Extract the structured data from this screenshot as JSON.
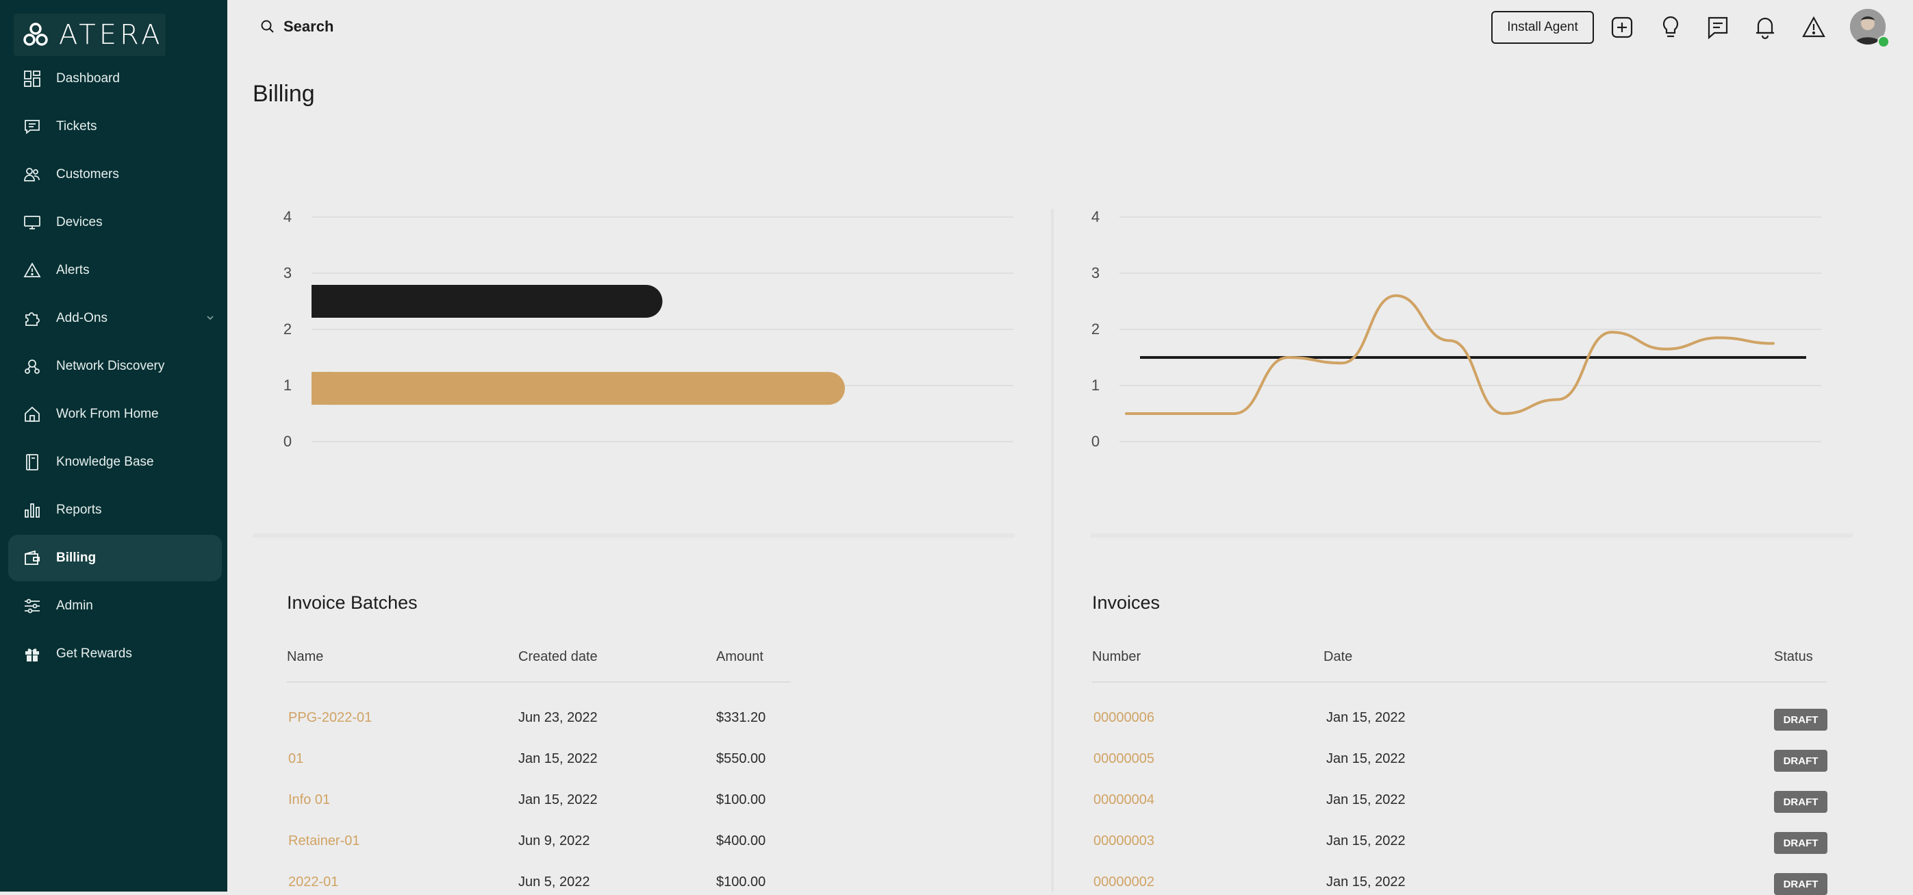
{
  "app": {
    "logo_text": "ATERA"
  },
  "sidebar": {
    "items": [
      {
        "label": "Dashboard",
        "icon": "dashboard-icon"
      },
      {
        "label": "Tickets",
        "icon": "tickets-icon"
      },
      {
        "label": "Customers",
        "icon": "customers-icon"
      },
      {
        "label": "Devices",
        "icon": "devices-icon"
      },
      {
        "label": "Alerts",
        "icon": "alerts-icon"
      },
      {
        "label": "Add-Ons",
        "icon": "addons-icon"
      },
      {
        "label": "Network Discovery",
        "icon": "network-icon"
      },
      {
        "label": "Work From Home",
        "icon": "home-icon"
      },
      {
        "label": "Knowledge Base",
        "icon": "book-icon"
      },
      {
        "label": "Reports",
        "icon": "reports-icon"
      },
      {
        "label": "Billing",
        "icon": "wallet-icon",
        "active": true
      },
      {
        "label": "Admin",
        "icon": "sliders-icon"
      },
      {
        "label": "Get Rewards",
        "icon": "gift-icon"
      }
    ]
  },
  "topbar": {
    "search_label": "Search",
    "install_agent": "Install Agent",
    "icons": [
      "plus-icon",
      "lightbulb-icon",
      "chat-icon",
      "bell-icon",
      "warning-icon"
    ]
  },
  "page": {
    "title": "Billing"
  },
  "colors": {
    "accent": "#d0a364",
    "sidebar": "#063033",
    "dark_bar": "#1c1c1c"
  },
  "chart_data": [
    {
      "type": "bar",
      "orientation": "horizontal",
      "y_ticks": [
        "4",
        "3",
        "2",
        "1",
        "0"
      ],
      "ylim": [
        0,
        4
      ],
      "series": [
        {
          "values": [
            2.5
          ],
          "color": "#1c1c1c"
        },
        {
          "values": [
            1
          ],
          "color": "#d0a364"
        }
      ],
      "bar_values_relative": [
        0.5,
        0.76
      ],
      "grid": true
    },
    {
      "type": "line",
      "y_ticks": [
        "4",
        "3",
        "2",
        "1",
        "0"
      ],
      "ylim": [
        0,
        4
      ],
      "series": [
        {
          "values": [
            0.5,
            0.5,
            0.5,
            1.5,
            1.4,
            2.6,
            1.8,
            0.5,
            0.75,
            1.95,
            1.65,
            1.85,
            1.75
          ],
          "color": "#d0a364"
        },
        {
          "values": [
            1.5,
            1.5
          ],
          "color": "#1c1c1c"
        }
      ],
      "grid": true
    }
  ],
  "invoice_batches": {
    "title": "Invoice Batches",
    "headers": [
      "Name",
      "Created date",
      "Amount"
    ],
    "rows": [
      {
        "name": "PPG-2022-01",
        "date": "Jun 23, 2022",
        "amount": "$331.20"
      },
      {
        "name": "01",
        "date": "Jan 15, 2022",
        "amount": "$550.00"
      },
      {
        "name": "Info 01",
        "date": "Jan 15, 2022",
        "amount": "$100.00"
      },
      {
        "name": "Retainer-01",
        "date": "Jun 9, 2022",
        "amount": "$400.00"
      },
      {
        "name": "2022-01",
        "date": "Jun 5, 2022",
        "amount": "$100.00"
      }
    ]
  },
  "invoices": {
    "title": "Invoices",
    "headers": [
      "Number",
      "Date",
      "Status"
    ],
    "rows": [
      {
        "number": "00000006",
        "date": "Jan 15, 2022",
        "status": "DRAFT"
      },
      {
        "number": "00000005",
        "date": "Jan 15, 2022",
        "status": "DRAFT"
      },
      {
        "number": "00000004",
        "date": "Jan 15, 2022",
        "status": "DRAFT"
      },
      {
        "number": "00000003",
        "date": "Jan 15, 2022",
        "status": "DRAFT"
      },
      {
        "number": "00000002",
        "date": "Jan 15, 2022",
        "status": "DRAFT"
      }
    ]
  }
}
